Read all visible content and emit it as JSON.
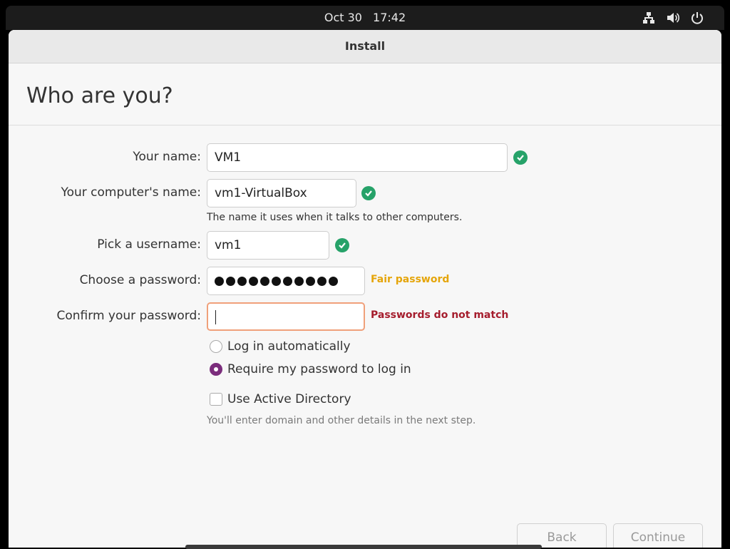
{
  "topbar": {
    "date": "Oct 30",
    "time": "17:42"
  },
  "window": {
    "title": "Install"
  },
  "page": {
    "heading": "Who are you?"
  },
  "form": {
    "name_label": "Your name:",
    "name_value": "VM1",
    "computer_label": "Your computer's name:",
    "computer_value": "vm1-VirtualBox",
    "computer_hint": "The name it uses when it talks to other computers.",
    "username_label": "Pick a username:",
    "username_value": "vm1",
    "password_label": "Choose a password:",
    "password_status": "Fair password",
    "confirm_label": "Confirm your password:",
    "confirm_status": "Passwords do not match",
    "login_auto_label": "Log in automatically",
    "login_require_label": "Require my password to log in",
    "active_directory_label": "Use Active Directory",
    "active_directory_hint": "You'll enter domain and other details in the next step."
  },
  "buttons": {
    "back": "Back",
    "continue": "Continue"
  },
  "colors": {
    "ok": "#26a269",
    "warning": "#e5a50a",
    "error": "#a51d2d",
    "accent": "#7b2d7c"
  }
}
